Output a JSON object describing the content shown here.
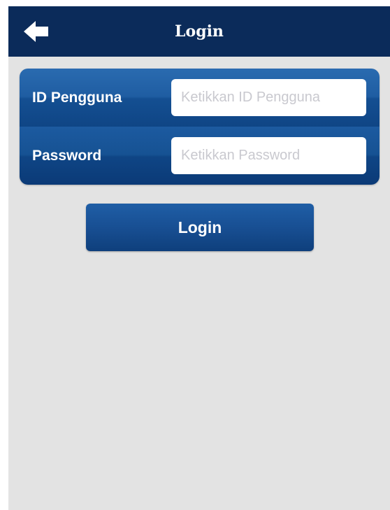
{
  "navbar": {
    "title": "Login",
    "back_icon": "arrow-left-icon"
  },
  "form": {
    "user_id": {
      "label": "ID Pengguna",
      "value": "",
      "placeholder": "Ketikkan ID Pengguna"
    },
    "password": {
      "label": "Password",
      "value": "",
      "placeholder": "Ketikkan Password"
    }
  },
  "login_button": {
    "label": "Login"
  },
  "colors": {
    "navbar": "#0b2b5a",
    "accent": "#1a5399",
    "background": "#e3e3e3"
  }
}
